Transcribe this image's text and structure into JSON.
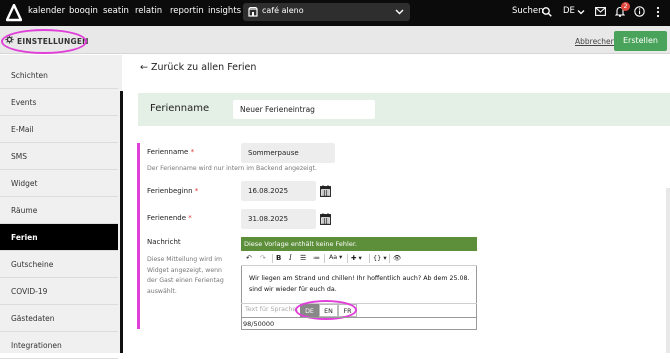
{
  "topnav": {
    "items": [
      "kalender",
      "booqin",
      "seatin",
      "relatin",
      "reportin",
      "insights"
    ],
    "venue": "café aleno",
    "search_label": "Suchen",
    "language": "DE",
    "notification_count": "2"
  },
  "settings": {
    "title": "EINSTELLUNGEN",
    "cancel_label": "Abbrechen",
    "create_label": "Erstellen"
  },
  "sidebar": {
    "items": [
      {
        "label": "Schichten"
      },
      {
        "label": "Events"
      },
      {
        "label": "E-Mail"
      },
      {
        "label": "SMS"
      },
      {
        "label": "Widget"
      },
      {
        "label": "Räume"
      },
      {
        "label": "Ferien"
      },
      {
        "label": "Gutscheine"
      },
      {
        "label": "COVID-19"
      },
      {
        "label": "Gästedaten"
      },
      {
        "label": "Integrationen"
      }
    ],
    "active": "Ferien"
  },
  "main": {
    "back_label": "← Zurück zu allen Ferien",
    "name_panel": {
      "label": "Ferienname",
      "value": "Neuer Ferieneintrag"
    },
    "form": {
      "name_label": "Ferienname",
      "name_value": "Sommerpause",
      "name_hint": "Der Ferienname wird nur intern im Backend angezeigt.",
      "start_label": "Ferienbeginn",
      "start_value": "16.08.2025",
      "end_label": "Ferienende",
      "end_value": "31.08.2025",
      "message_label": "Nachricht",
      "message_hint": "Diese Mitteilung wird im Widget angezeigt, wenn der Gast einen Ferientag auswählt.",
      "required_mark": "*"
    },
    "editor": {
      "banner": "Diese Vorlage enthält keine Fehler.",
      "toolbar": {
        "undo": "↶",
        "redo": "↷",
        "bold": "B",
        "italic": "I",
        "list": "☰",
        "numbered": "≔",
        "font_size": "Aa ▾",
        "insert": "✚ ▾",
        "variable": "{} ▾",
        "preview": "👁"
      },
      "text": "Wir liegen am Strand und chillen! Ihr hoffentlich auch? Ab dem 25.08. sind wir wieder für euch da.",
      "language_placeholder": "Text für Sprache:",
      "languages": [
        "DE",
        "EN",
        "FR"
      ],
      "selected_language": "DE",
      "counter": "98/50000"
    }
  },
  "colors": {
    "highlight": "#e13fd9",
    "green": "#4aa35b",
    "banner": "#5d8f3b"
  }
}
